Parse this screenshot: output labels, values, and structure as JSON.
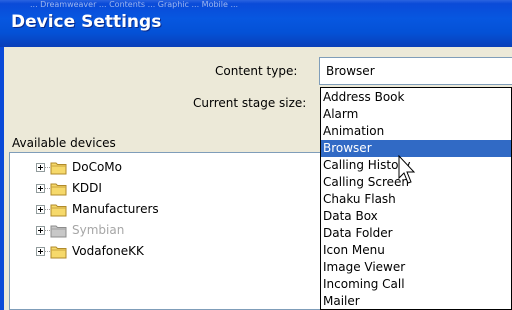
{
  "window": {
    "title": "Device Settings",
    "title_ghost": "...   Dreamweaver   ...   Contents   ...   Graphic   ...   Mobile   ..."
  },
  "form": {
    "content_type_label": "Content type:",
    "content_type_value": "Browser",
    "stage_size_label": "Current stage size:"
  },
  "devices": {
    "label": "Available devices",
    "items": [
      {
        "label": "DoCoMo",
        "enabled": true
      },
      {
        "label": "KDDI",
        "enabled": true
      },
      {
        "label": "Manufacturers",
        "enabled": true
      },
      {
        "label": "Symbian",
        "enabled": false
      },
      {
        "label": "VodafoneKK",
        "enabled": true
      }
    ]
  },
  "dropdown": {
    "selected": "Browser",
    "options": [
      "Address Book",
      "Alarm",
      "Animation",
      "Browser",
      "Calling History",
      "Calling Screen",
      "Chaku Flash",
      "Data Box",
      "Data Folder",
      "Icon Menu",
      "Image Viewer",
      "Incoming Call",
      "Mailer"
    ]
  },
  "colors": {
    "titlebar": "#0a4ad8",
    "dialog_bg": "#ece9d8",
    "selection": "#316ac5",
    "folder": "#f6d96b",
    "folder_disabled": "#c0c0c0"
  },
  "icons": {
    "folder": "folder-icon",
    "expander": "plus-expander-icon",
    "cursor": "arrow-cursor-icon"
  }
}
